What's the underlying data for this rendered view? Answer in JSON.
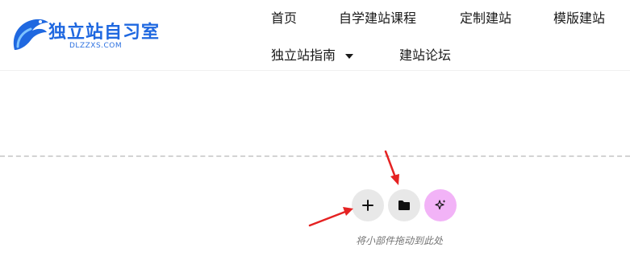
{
  "site": {
    "logo_title": "独立站自习室",
    "logo_subtitle": "DLZZXS.COM"
  },
  "nav": {
    "items": [
      {
        "label": "首页"
      },
      {
        "label": "自学建站课程"
      },
      {
        "label": "定制建站"
      },
      {
        "label": "模版建站"
      },
      {
        "label": "独立站指南"
      },
      {
        "label": "建站论坛"
      }
    ]
  },
  "editor": {
    "drop_hint": "将小部件拖动到此处",
    "buttons": [
      {
        "icon": "plus-icon"
      },
      {
        "icon": "folder-icon"
      },
      {
        "icon": "sparkle-icon"
      }
    ]
  },
  "colors": {
    "brand_blue": "#1f68e0",
    "button_gray": "#e8e8e8",
    "ai_pink": "#f2b3f7",
    "annotation_red": "#e52222"
  }
}
